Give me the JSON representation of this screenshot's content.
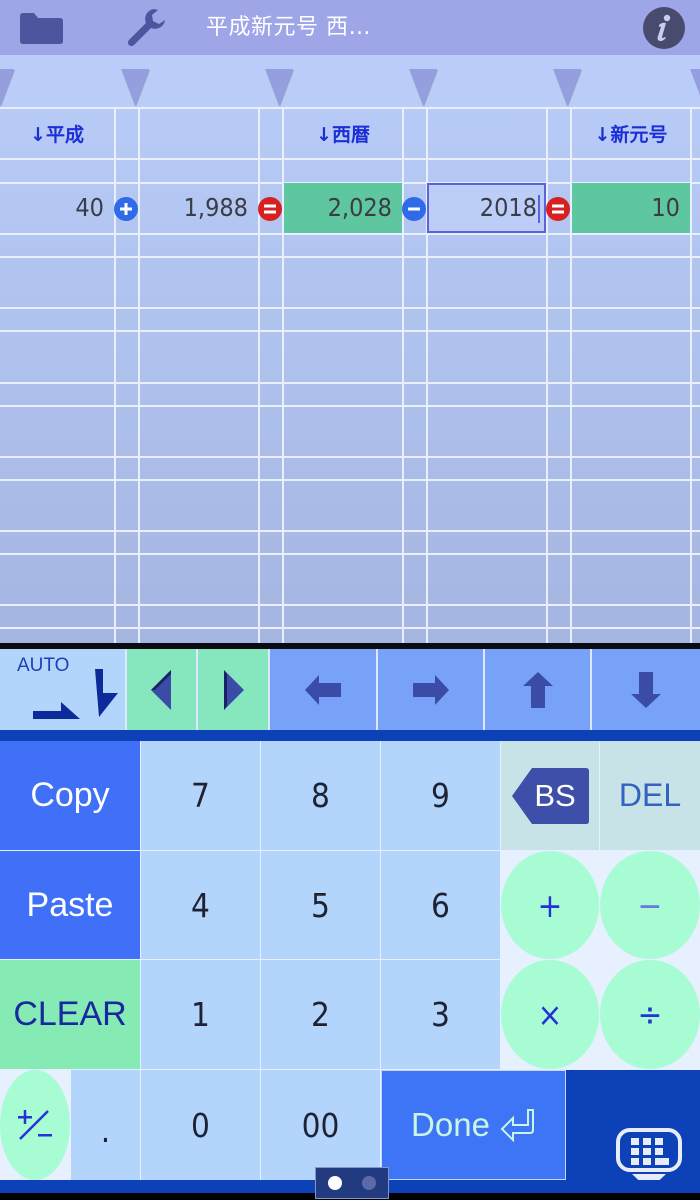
{
  "app": {
    "title": "平成新元号 西…",
    "icons": {
      "folder": "folder-icon",
      "settings": "wrench-icon",
      "info": "info-icon"
    }
  },
  "sheet": {
    "headers": [
      "↓平成",
      "",
      "↓西暦",
      "",
      "↓新元号"
    ],
    "row": {
      "cells": [
        {
          "value": "40",
          "highlight": false
        },
        {
          "value": "1,988",
          "highlight": false
        },
        {
          "value": "2,028",
          "highlight": true
        },
        {
          "value": "2018",
          "editing": true
        },
        {
          "value": "10",
          "highlight": true
        }
      ],
      "operators": [
        {
          "symbol": "+",
          "icon": "plus-circle-icon"
        },
        {
          "symbol": "=",
          "icon": "equals-circle-icon"
        },
        {
          "symbol": "−",
          "icon": "minus-circle-icon"
        },
        {
          "symbol": "=",
          "icon": "equals-circle-icon"
        }
      ]
    },
    "colors": {
      "result": "#5fc79f",
      "plus_minus": "#2f6ae8",
      "equals": "#d92020",
      "header_text": "#1c2fd6"
    }
  },
  "toolbar": {
    "auto_label": "AUTO",
    "buttons": [
      "auto-direction",
      "cursor-left",
      "cursor-right",
      "move-left",
      "move-right",
      "move-up",
      "move-down"
    ]
  },
  "keypad": {
    "copy": "Copy",
    "paste": "Paste",
    "clear": "CLEAR",
    "digits": {
      "7": "7",
      "8": "8",
      "9": "9",
      "4": "4",
      "5": "5",
      "6": "6",
      "1": "1",
      "2": "2",
      "3": "3",
      "0": "0",
      "00": "00"
    },
    "dot": ".",
    "plusminus": "+/−",
    "backspace": "BS",
    "delete": "DEL",
    "add": "+",
    "subtract": "−",
    "multiply": "×",
    "divide": "÷",
    "done": "Done"
  },
  "pager": {
    "pages": 2,
    "current": 1
  }
}
